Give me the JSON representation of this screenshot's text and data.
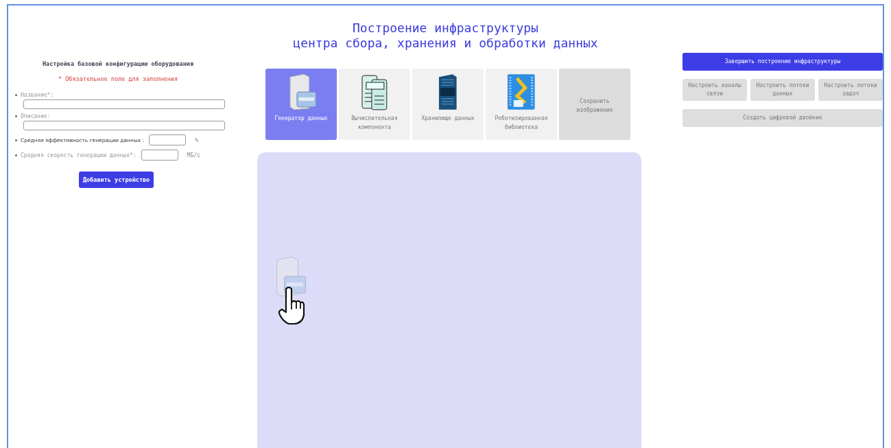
{
  "title": [
    "Построение инфраструктуры",
    "центра сбора, хранения и обработки данных"
  ],
  "config_form": {
    "heading": "Настройка базовой конфигурации оборудования",
    "required_note": "* Обязательное поле для заполнения",
    "fields": [
      {
        "kind": "wide",
        "label": "Название*:"
      },
      {
        "kind": "wide",
        "label": "Описание:"
      },
      {
        "kind": "inline",
        "label": "Средняя эффективность генерации данных :",
        "unit": "%"
      },
      {
        "kind": "inline",
        "label": "Средняя скорость генерации данных*:",
        "unit": "MБ/с"
      }
    ],
    "submit": "Добавить устройство"
  },
  "device_tiles": [
    {
      "kind": "generator",
      "label": "Генератор данных",
      "selected": true,
      "disabled": false
    },
    {
      "kind": "compute",
      "label": "Вычислительная компонента",
      "selected": false,
      "disabled": false
    },
    {
      "kind": "storage",
      "label": "Хранилище данных",
      "selected": false,
      "disabled": false
    },
    {
      "kind": "library",
      "label": "Роботизированная библиотека",
      "selected": false,
      "disabled": false
    },
    {
      "kind": "action",
      "label": "Сохранить изображение",
      "selected": false,
      "disabled": true
    }
  ],
  "canvas": {
    "dragged_item": {
      "kind": "generator"
    }
  },
  "actions": {
    "finish": {
      "label": "Завершить построение инфраструктуры",
      "disabled": false
    },
    "setup": [
      {
        "label": "Настроить каналы связи",
        "disabled": true
      },
      {
        "label": "Настроить потоки данных",
        "disabled": true
      },
      {
        "label": "Настроить потоки задач",
        "disabled": true
      }
    ],
    "twin": {
      "label": "Создать цифровой двойник",
      "disabled": true
    }
  }
}
